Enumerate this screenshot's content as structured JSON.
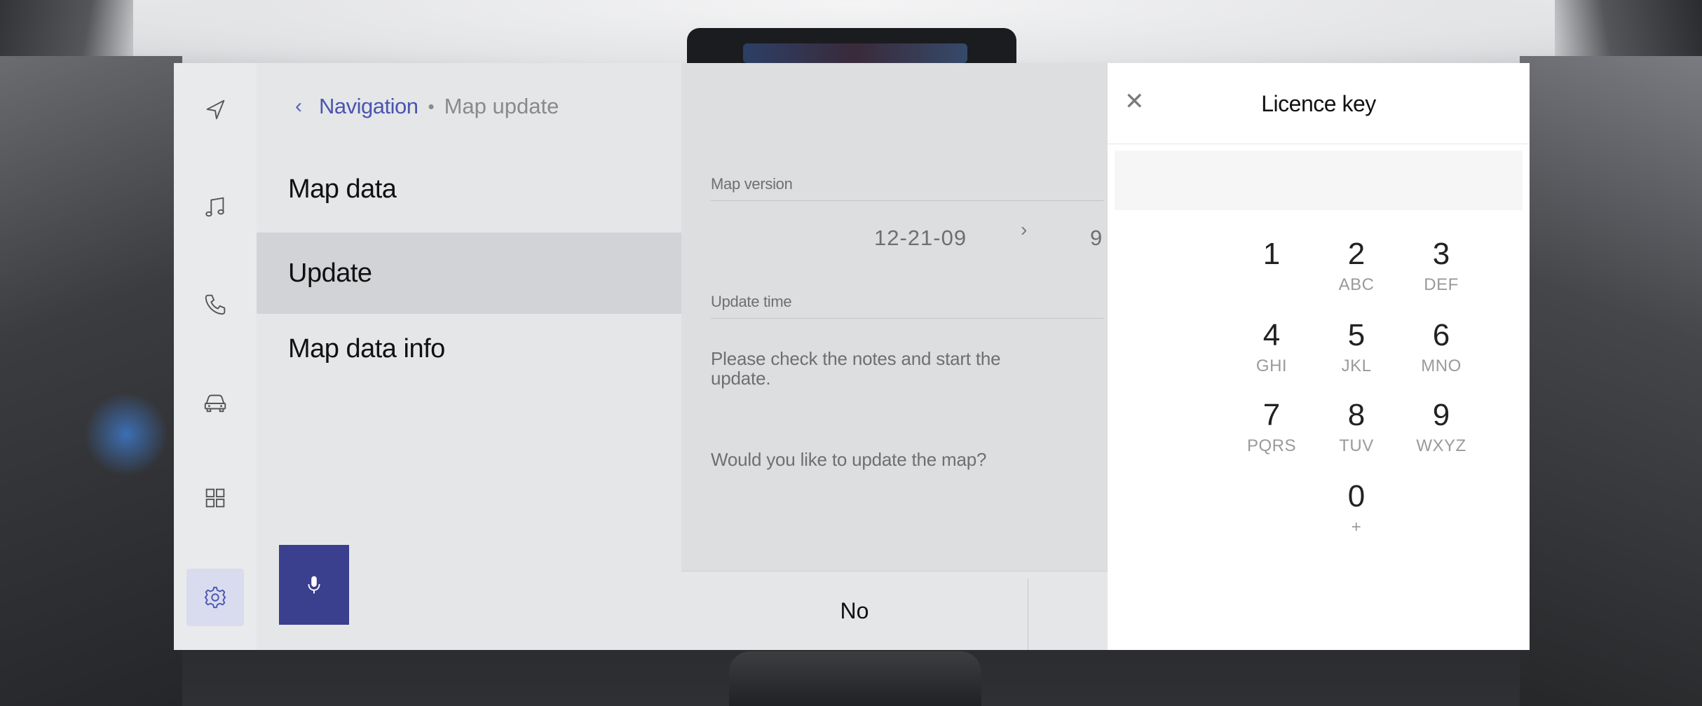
{
  "breadcrumb": {
    "parent": "Navigation",
    "current": "Map update"
  },
  "menu": {
    "items": [
      {
        "label": "Map data",
        "selected": false
      },
      {
        "label": "Update",
        "selected": true
      },
      {
        "label": "Map data info",
        "selected": false
      }
    ]
  },
  "sidebar": {
    "icons": [
      "navigation-icon",
      "music-icon",
      "phone-icon",
      "car-icon",
      "apps-grid-icon",
      "settings-icon"
    ],
    "active": "settings-icon"
  },
  "detail": {
    "map_version_label": "Map version",
    "map_version_value": "12-21-09",
    "map_version_next_partial": "9",
    "update_time_label": "Update time",
    "notes_line1": "Please check the notes and start the",
    "notes_line2": "update.",
    "question": "Would you like to update the map?",
    "no_button": "No"
  },
  "dialog": {
    "title": "Licence key",
    "field_value": "",
    "keys": [
      {
        "digit": "1",
        "letters": ""
      },
      {
        "digit": "2",
        "letters": "ABC"
      },
      {
        "digit": "3",
        "letters": "DEF"
      },
      {
        "digit": "4",
        "letters": "GHI"
      },
      {
        "digit": "5",
        "letters": "JKL"
      },
      {
        "digit": "6",
        "letters": "MNO"
      },
      {
        "digit": "7",
        "letters": "PQRS"
      },
      {
        "digit": "8",
        "letters": "TUV"
      },
      {
        "digit": "9",
        "letters": "WXYZ"
      },
      {
        "digit": "0",
        "letters": "+"
      }
    ]
  },
  "colors": {
    "accent": "#4a55b0",
    "mic_button": "#3a3f8e",
    "selected_row": "#d2d3d6"
  }
}
